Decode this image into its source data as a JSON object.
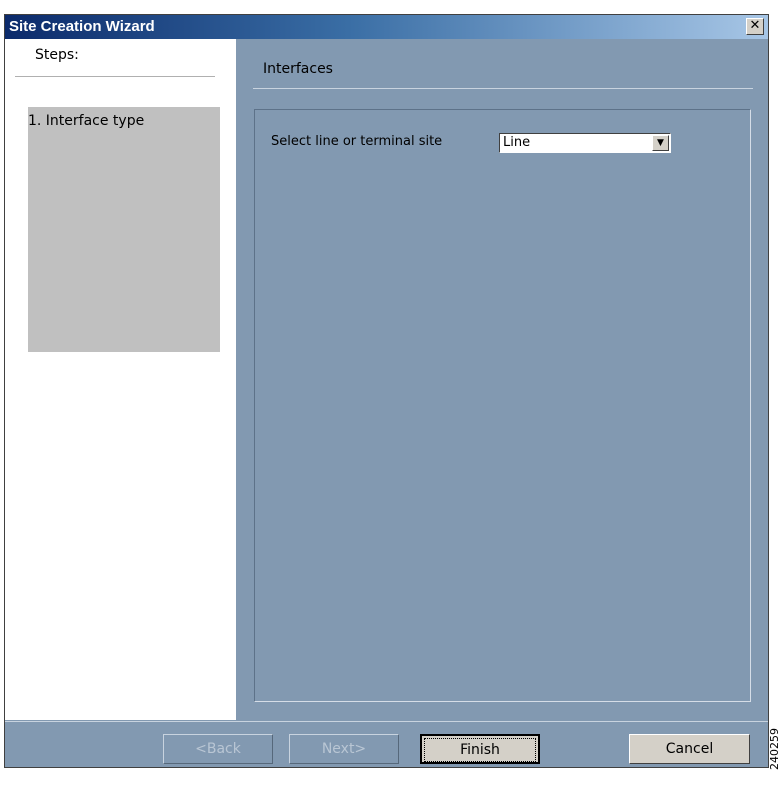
{
  "window": {
    "title": "Site Creation Wizard",
    "close_glyph": "✕"
  },
  "steps": {
    "label": "Steps:",
    "items": [
      {
        "label": "1. Interface type"
      }
    ]
  },
  "page": {
    "title": "Interfaces",
    "field_label": "Select line or terminal site",
    "select_value": "Line",
    "select_arrow": "▼"
  },
  "buttons": {
    "back": "<Back",
    "next": "Next>",
    "finish": "Finish",
    "cancel": "Cancel"
  },
  "figure_code": "240259",
  "colors": {
    "background": "#8299b1",
    "steps_box": "#c0c0c0",
    "title_gradient_start": "#0b2a6b"
  }
}
